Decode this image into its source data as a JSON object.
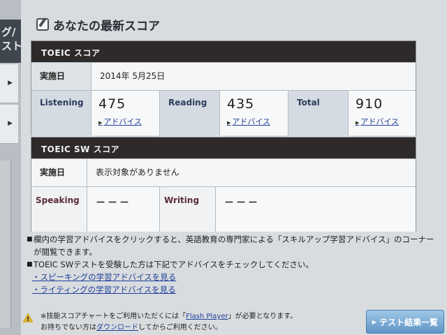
{
  "sidebar": {
    "block_text": "グ/\nスト"
  },
  "heading": {
    "title": "あなたの最新スコア"
  },
  "toeic": {
    "header": "TOEIC スコア",
    "date_label": "実施日",
    "date_value": "2014年 5月25日",
    "listening_label": "Listening",
    "listening_score": "475",
    "reading_label": "Reading",
    "reading_score": "435",
    "total_label": "Total",
    "total_score": "910",
    "advice_label": "アドバイス"
  },
  "sw": {
    "header": "TOEIC SW スコア",
    "date_label": "実施日",
    "date_value": "表示対象がありません",
    "speaking_label": "Speaking",
    "speaking_score": "－－－",
    "writing_label": "Writing",
    "writing_score": "－－－"
  },
  "notes": {
    "note1_a": "欄内の学習アドバイスをクリックすると、英語教育の専門家による「スキルアップ学習アドバイス」のコーナー",
    "note1_b": "が閲覧できます。",
    "note2": "TOEIC SWテストを受験した方は下記でアドバイスをチェックしてください。",
    "link_speaking": "・スピーキングの学習アドバイスを見る",
    "link_writing": "・ライティングの学習アドバイスを見る"
  },
  "footer": {
    "line1_a": "※技能スコアチャートをご利用いただくには「",
    "flash_link": "Flash Player",
    "line1_b": "」が必要となります。",
    "line2_a": "お持ちでない方は",
    "download_link": "ダウンロード",
    "line2_b": "してからご利用ください。"
  },
  "buttons": {
    "result_list": "テスト結果一覧"
  },
  "colors": {
    "table_header": "#2e2a2a",
    "link": "#1d3f99",
    "button": "#5f95c6"
  }
}
